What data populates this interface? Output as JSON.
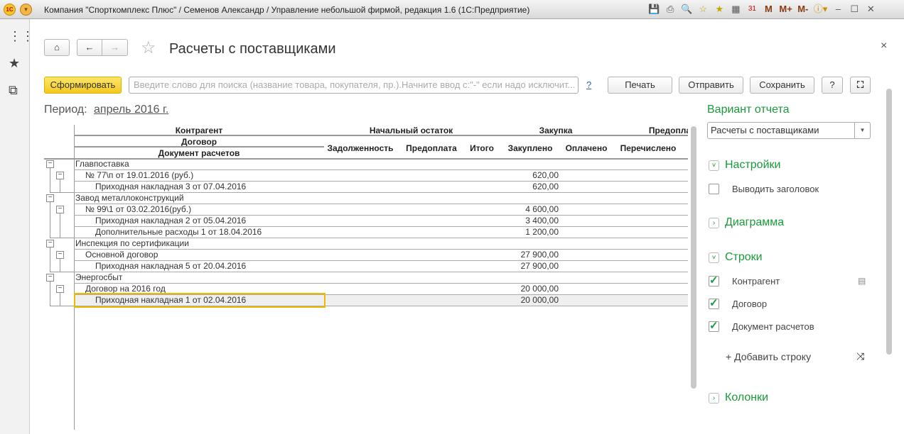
{
  "window": {
    "title": "Компания \"Спорткомплекс Плюс\" / Семенов Александр / Управление небольшой фирмой, редакция 1.6  (1С:Предприятие)",
    "logo": "1С",
    "toolbar_icons": [
      "save-icon",
      "print-icon",
      "preview-icon",
      "add-favorite-icon",
      "favorites-icon",
      "calculator-icon",
      "calendar-icon"
    ],
    "memory": [
      "M",
      "M+",
      "M-"
    ],
    "calendar_day": "31"
  },
  "header": {
    "title": "Расчеты с поставщиками"
  },
  "toolbar": {
    "generate": "Сформировать",
    "search_placeholder": "Введите слово для поиска (название товара, покупателя, пр.).Начните ввод с:\"-\" если надо исключит...",
    "help": "?",
    "print": "Печать",
    "send": "Отправить",
    "save": "Сохранить",
    "help_btn": "?"
  },
  "period": {
    "label": "Период:",
    "value": "апрель 2016 г."
  },
  "report": {
    "headers": {
      "counterparty": "Контрагент",
      "contract": "Договор",
      "document": "Документ расчетов",
      "opening": "Начальный остаток",
      "purchase": "Закупка",
      "prepay": "Предопла",
      "debt": "Задолженность",
      "prepayment": "Предоплата",
      "total": "Итого",
      "purchased": "Закуплено",
      "paid": "Оплачено",
      "transferred": "Перечислено"
    },
    "rows": [
      {
        "level": 0,
        "text": "Главпоставка",
        "purchased": ""
      },
      {
        "level": 1,
        "text": "№ 77\\п от 19.01.2016 (руб.)",
        "purchased": "620,00"
      },
      {
        "level": 2,
        "text": "Приходная накладная 3 от 07.04.2016",
        "purchased": "620,00"
      },
      {
        "level": 0,
        "text": "Завод металлоконструкций",
        "purchased": ""
      },
      {
        "level": 1,
        "text": "№ 99\\1 от 03.02.2016(руб.)",
        "purchased": "4 600,00"
      },
      {
        "level": 2,
        "text": "Приходная накладная 2 от 05.04.2016",
        "purchased": "3 400,00"
      },
      {
        "level": 2,
        "text": "Дополнительные расходы 1 от 18.04.2016",
        "purchased": "1 200,00"
      },
      {
        "level": 0,
        "text": "Инспекция по сертификации",
        "purchased": ""
      },
      {
        "level": 1,
        "text": "Основной договор",
        "purchased": "27 900,00"
      },
      {
        "level": 2,
        "text": "Приходная накладная 5 от 20.04.2016",
        "purchased": "27 900,00"
      },
      {
        "level": 0,
        "text": "Энергосбыт",
        "purchased": ""
      },
      {
        "level": 1,
        "text": "Договор на 2016 год",
        "purchased": "20 000,00"
      },
      {
        "level": 2,
        "text": "Приходная накладная 1 от 02.04.2016",
        "purchased": "20 000,00",
        "selected": true
      }
    ]
  },
  "settings": {
    "variant_title": "Вариант отчета",
    "variant_value": "Расчеты с поставщиками",
    "sections": {
      "settings": "Настройки",
      "chart": "Диаграмма",
      "rows": "Строки",
      "columns": "Колонки"
    },
    "show_header": {
      "label": "Выводить заголовок",
      "checked": false
    },
    "row_items": [
      {
        "label": "Контрагент",
        "checked": true
      },
      {
        "label": "Договор",
        "checked": true
      },
      {
        "label": "Документ расчетов",
        "checked": true
      }
    ],
    "add_row": "+ Добавить строку"
  }
}
